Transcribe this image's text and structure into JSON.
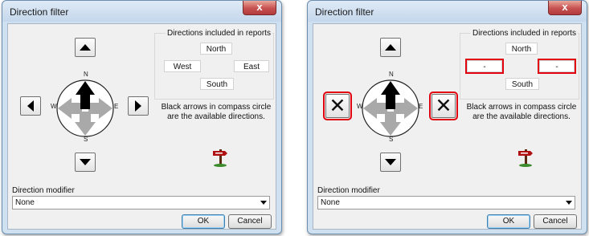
{
  "dialogs": [
    {
      "title": "Direction filter",
      "close_label": "x",
      "compass_labels": {
        "n": "N",
        "s": "S",
        "e": "E",
        "w": "W"
      },
      "group_label": "Directions included in reports",
      "directions": {
        "north": "North",
        "west": "West",
        "east": "East",
        "south": "South"
      },
      "note": "Black arrows in compass circle are the available directions.",
      "modifier_label": "Direction modifier",
      "modifier_value": "None",
      "ok_label": "OK",
      "cancel_label": "Cancel"
    },
    {
      "title": "Direction filter",
      "close_label": "x",
      "compass_labels": {
        "n": "N",
        "s": "S",
        "e": "E",
        "w": "W"
      },
      "group_label": "Directions included in reports",
      "directions": {
        "north": "North",
        "west": "-",
        "east": "-",
        "south": "South"
      },
      "side_button_mark": "✕",
      "note": "Black arrows in compass circle are the available directions.",
      "modifier_label": "Direction modifier",
      "modifier_value": "None",
      "ok_label": "OK",
      "cancel_label": "Cancel"
    }
  ],
  "colors": {
    "highlight": "#e0000e",
    "titlebar": "#cfe0f1",
    "close": "#c75050"
  },
  "icons": [
    "arrow-up-icon",
    "arrow-down-icon",
    "arrow-left-icon",
    "arrow-right-icon",
    "compass-icon",
    "signpost-icon",
    "close-icon",
    "dropdown-arrow-icon"
  ]
}
